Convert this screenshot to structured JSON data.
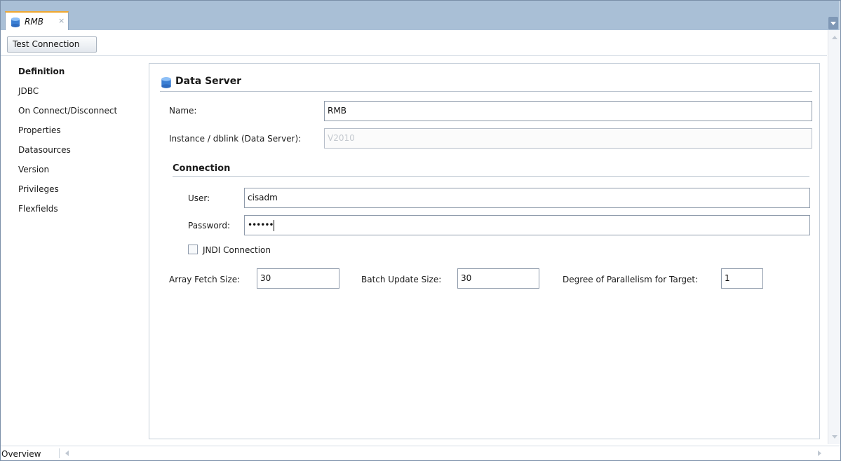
{
  "tab": {
    "title": "RMB",
    "close": "×"
  },
  "toolbar": {
    "test_connection": "Test Connection"
  },
  "nav": {
    "items": [
      "Definition",
      "JDBC",
      "On Connect/Disconnect",
      "Properties",
      "Datasources",
      "Version",
      "Privileges",
      "Flexfields"
    ]
  },
  "section": {
    "title": "Data Server"
  },
  "form": {
    "name_label": "Name:",
    "name_value": "RMB",
    "instance_label": "Instance / dblink (Data Server):",
    "instance_value": "V2010",
    "connection_heading": "Connection",
    "user_label": "User:",
    "user_value": "cisadm",
    "password_label": "Password:",
    "password_value": "••••••",
    "jndi_label": "JNDI Connection",
    "array_fetch_label": "Array Fetch Size:",
    "array_fetch_value": "30",
    "batch_update_label": "Batch Update Size:",
    "batch_update_value": "30",
    "parallelism_label": "Degree of Parallelism for Target:",
    "parallelism_value": "1"
  },
  "bottom": {
    "overview_tab": "Overview"
  },
  "icons": {
    "tab_icon": "database-icon",
    "section_icon": "database-icon"
  },
  "colors": {
    "tabstrip": "#a9bfd6",
    "active_tab_accent": "#f0a830",
    "db_icon": "#3b7fd4"
  }
}
